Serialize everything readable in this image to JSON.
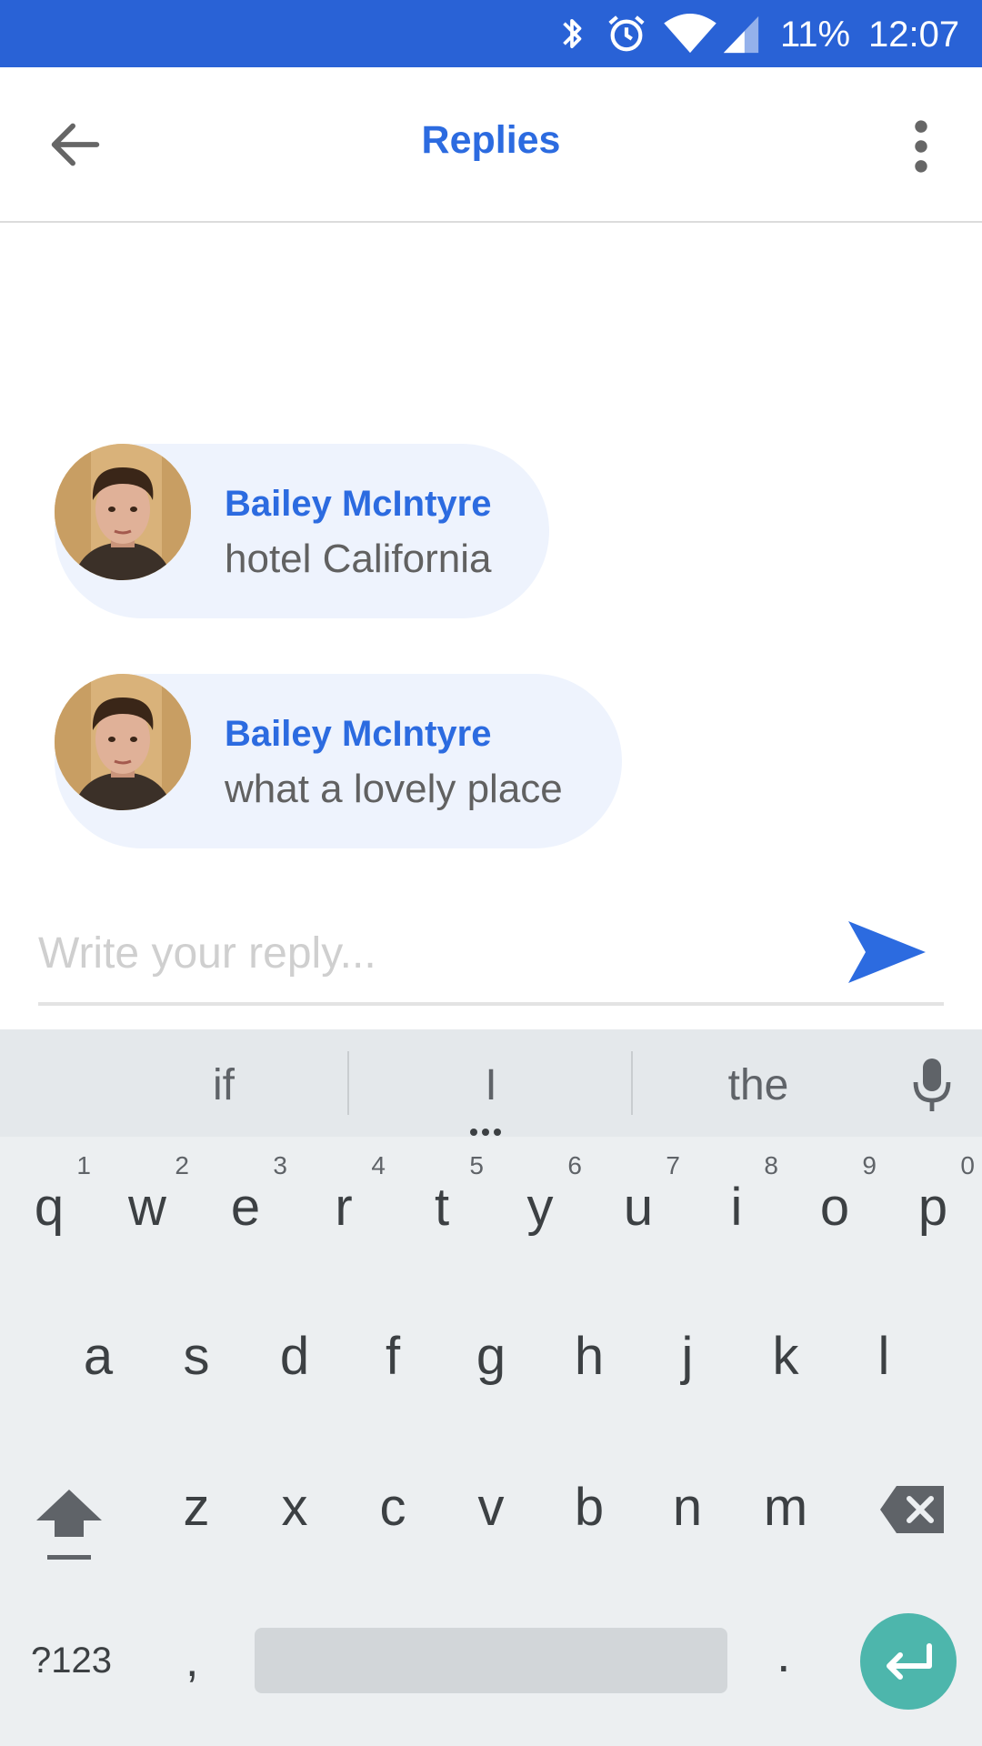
{
  "status_bar": {
    "battery": "11%",
    "time": "12:07",
    "icons": [
      "bluetooth-icon",
      "alarm-icon",
      "wifi-icon",
      "signal-icon"
    ]
  },
  "app_bar": {
    "title": "Replies",
    "back_icon": "arrow-back-icon",
    "menu_icon": "more-vert-icon"
  },
  "messages": [
    {
      "name": "Bailey McIntyre",
      "text": "hotel California"
    },
    {
      "name": "Bailey McIntyre",
      "text": "what a lovely place"
    }
  ],
  "reply": {
    "placeholder": "Write your reply...",
    "value": "",
    "send_icon": "send-icon"
  },
  "keyboard": {
    "suggestions": [
      "if",
      "I",
      "the"
    ],
    "row1": [
      {
        "letter": "q",
        "hint": "1"
      },
      {
        "letter": "w",
        "hint": "2"
      },
      {
        "letter": "e",
        "hint": "3"
      },
      {
        "letter": "r",
        "hint": "4"
      },
      {
        "letter": "t",
        "hint": "5"
      },
      {
        "letter": "y",
        "hint": "6"
      },
      {
        "letter": "u",
        "hint": "7"
      },
      {
        "letter": "i",
        "hint": "8"
      },
      {
        "letter": "o",
        "hint": "9"
      },
      {
        "letter": "p",
        "hint": "0"
      }
    ],
    "row2": [
      "a",
      "s",
      "d",
      "f",
      "g",
      "h",
      "j",
      "k",
      "l"
    ],
    "row3": [
      "z",
      "x",
      "c",
      "v",
      "b",
      "n",
      "m"
    ],
    "symbols_label": "?123",
    "comma": ",",
    "period": "."
  },
  "colors": {
    "status_bar": "#2962d6",
    "accent": "#2c6be0",
    "bubble": "#eef3fd",
    "enter_key": "#4db6ac"
  }
}
